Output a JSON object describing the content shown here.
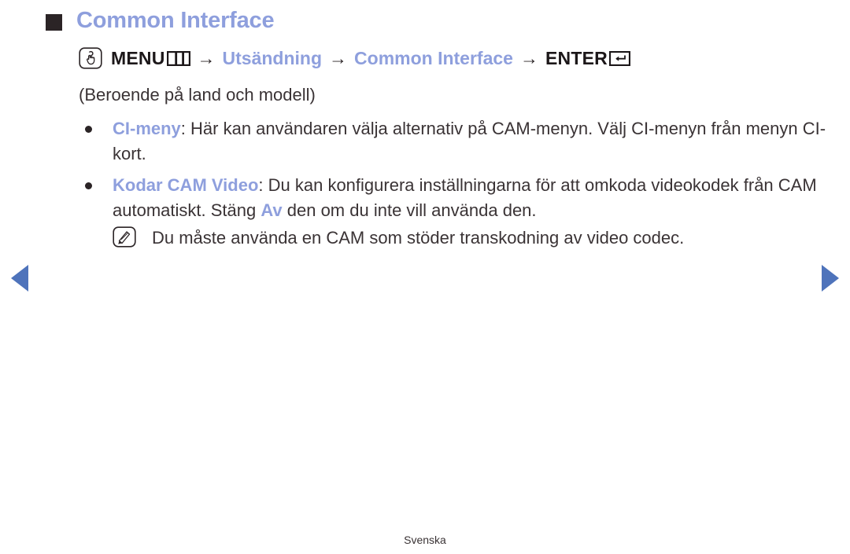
{
  "document": {
    "language_footer": "Svenska"
  },
  "heading": {
    "bullet_icon": "filled-square-bullet",
    "title": "Common Interface"
  },
  "menu_path": {
    "touch_icon": "touch-hand-icon",
    "menu_label": "MENU",
    "menu_bars_icon": "menu-bars-icon",
    "separator": "→",
    "step_broadcast": "Utsändning",
    "step_common_interface": "Common Interface",
    "enter_label": "ENTER",
    "enter_icon": "enter-return-icon"
  },
  "subnote": "(Beroende på land och modell)",
  "bullets": [
    {
      "term": "CI-meny",
      "separator": ": ",
      "text": "Här kan användaren välja alternativ på CAM-menyn. Välj CI-menyn från menyn CI-kort."
    },
    {
      "term": "Kodar CAM Video",
      "separator": ": ",
      "text_before": "Du kan konfigurera inställningarna för att omkoda videokodek från CAM automatiskt. Stäng ",
      "inline_term": "Av",
      "text_after": " den om du inte vill använda den."
    }
  ],
  "note": {
    "icon": "note-pencil-icon",
    "text": "Du måste använda en CAM som stöder transkodning av video codec."
  },
  "navigation": {
    "prev_icon": "previous-page-arrow-icon",
    "next_icon": "next-page-arrow-icon"
  },
  "colors": {
    "accent_blue": "#8e9fdd",
    "arrow_blue": "#4e73bb",
    "text": "#3a3335"
  }
}
